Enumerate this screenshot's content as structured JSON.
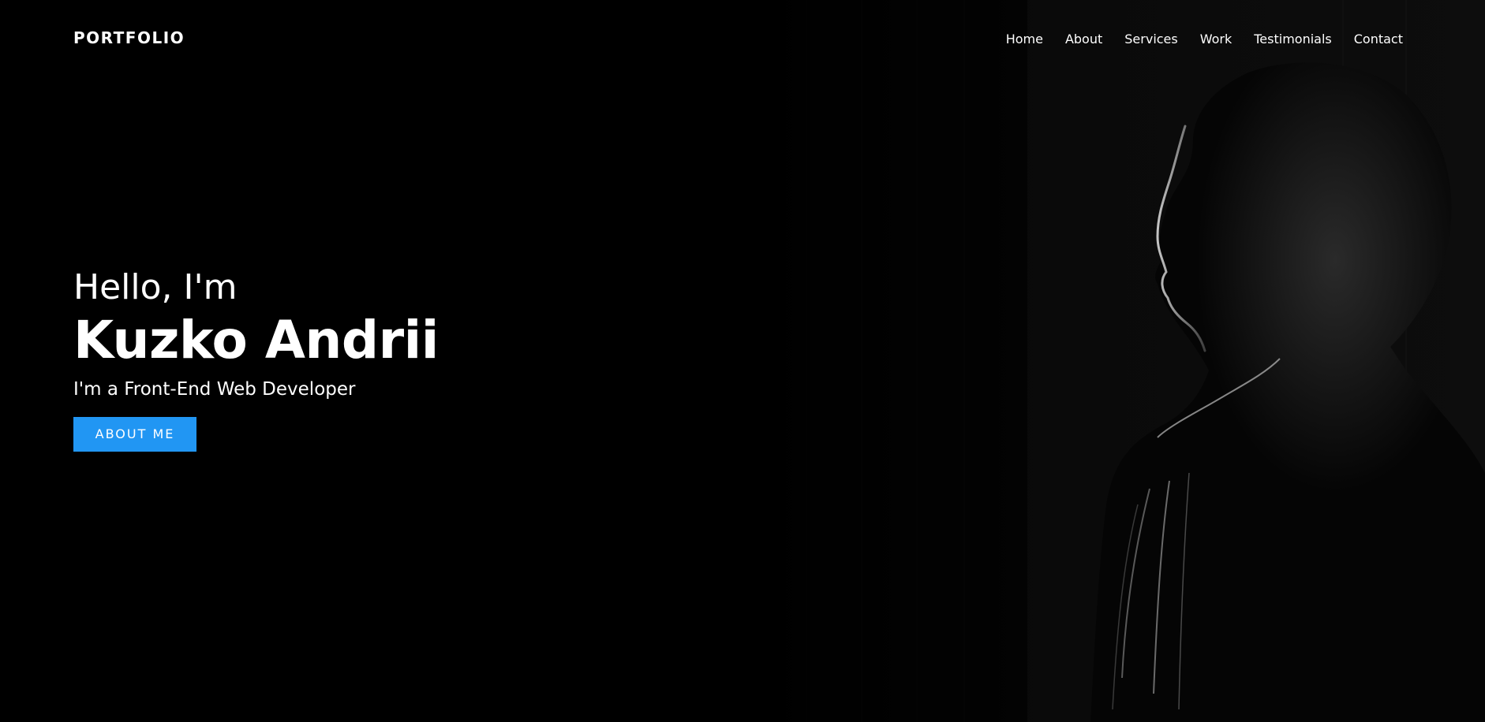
{
  "header": {
    "logo": "PORTFOLIO",
    "nav": [
      {
        "label": "Home"
      },
      {
        "label": "About"
      },
      {
        "label": "Services"
      },
      {
        "label": "Work"
      },
      {
        "label": "Testimonials"
      },
      {
        "label": "Contact"
      }
    ]
  },
  "hero": {
    "greeting": "Hello, I'm",
    "name": "Kuzko Andrii",
    "subtitle": "I'm a Front-End Web Developer",
    "button_label": "ABOUT ME"
  },
  "colors": {
    "background": "#000000",
    "text": "#ffffff",
    "accent": "#2196f3"
  },
  "images": {
    "hero_photo": "dark-profile-portrait"
  }
}
